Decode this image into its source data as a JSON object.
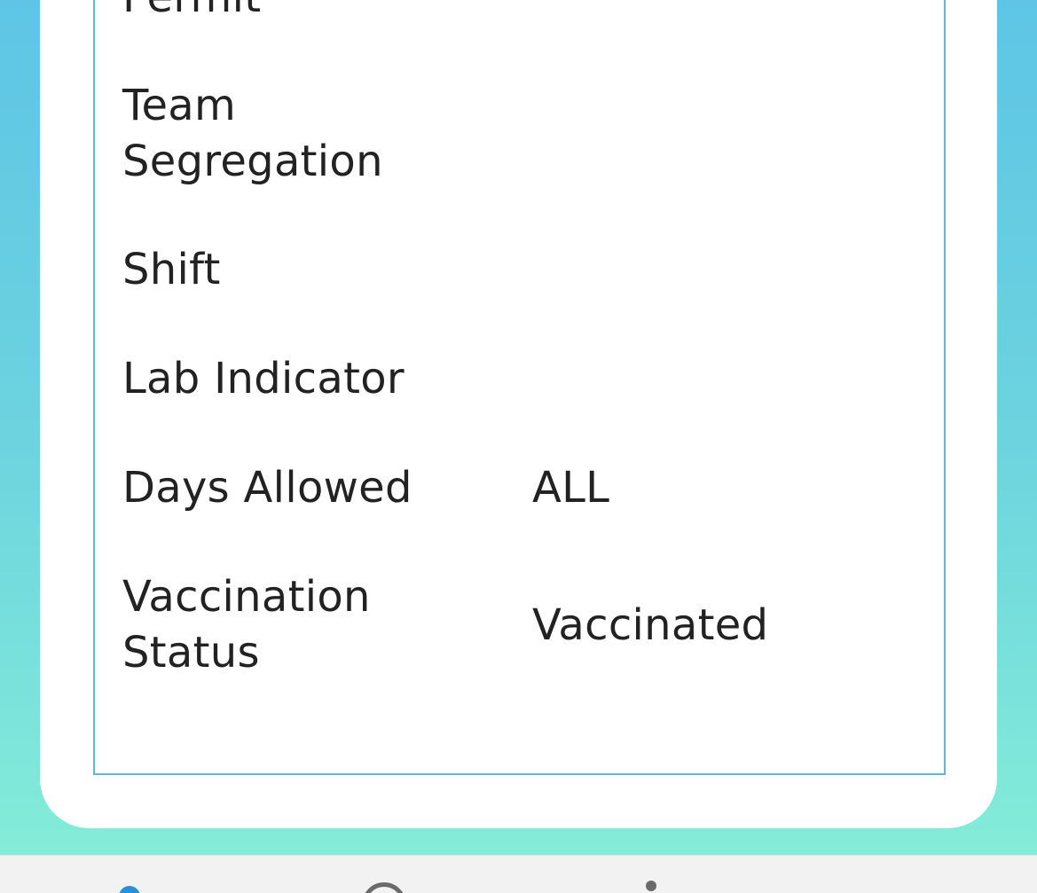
{
  "colors": {
    "background_top": "#5ec5e6",
    "background_bottom": "#84ecd8",
    "panel_border": "#5cb8dc",
    "text": "#222222",
    "nav_active": "#2b8fd6",
    "nav_inactive": "#6b6b6b"
  },
  "details": {
    "cut_label": "Permit",
    "rows": [
      {
        "label_line1": "Team",
        "label_line2": "Segregation",
        "value": ""
      },
      {
        "label": "Shift",
        "value": ""
      },
      {
        "label": "Lab Indicator",
        "value": ""
      },
      {
        "label": "Days Allowed",
        "value": "ALL"
      },
      {
        "label_line1": "Vaccination",
        "label_line2": "Status",
        "value": "Vaccinated"
      }
    ]
  },
  "bottom_nav": {
    "items": [
      {
        "icon": "home-icon",
        "active": true
      },
      {
        "icon": "circle-icon",
        "active": false
      },
      {
        "icon": "info-icon",
        "active": false
      }
    ]
  }
}
